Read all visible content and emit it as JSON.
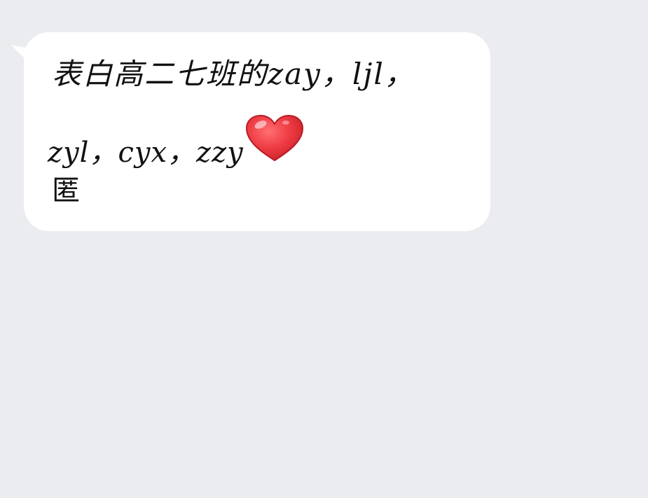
{
  "message": {
    "line1": "表白高二七班的zay，ljl，",
    "line2": "zyl，cyx，zzy",
    "line3": "匿"
  },
  "emoji": {
    "icon": "heart-icon",
    "color": "#e8323b"
  },
  "colors": {
    "background": "#ebecf0",
    "bubble": "#ffffff",
    "text": "#111111"
  }
}
